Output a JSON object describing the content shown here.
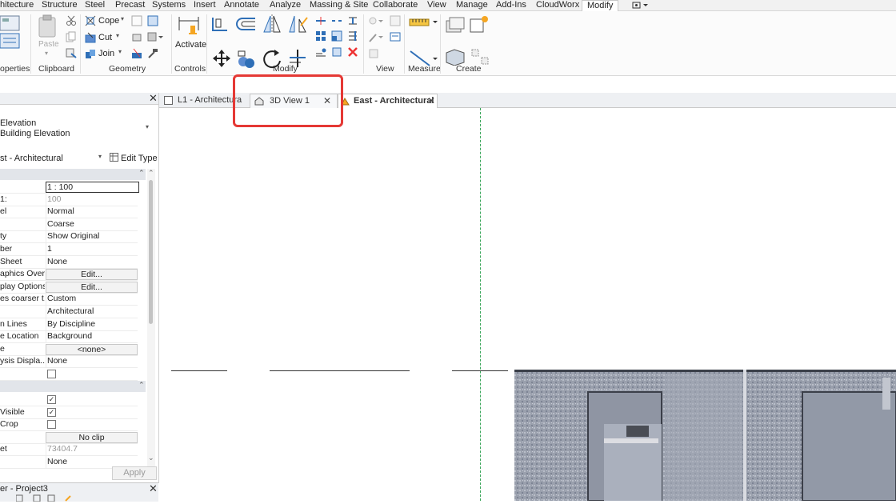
{
  "ribbon_tabs": [
    "hitecture",
    "Structure",
    "Steel",
    "Precast",
    "Systems",
    "Insert",
    "Annotate",
    "Analyze",
    "Massing & Site",
    "Collaborate",
    "View",
    "Manage",
    "Add-Ins",
    "CloudWorx",
    "Modify"
  ],
  "ribbon_panels": {
    "properties": "operties",
    "clipboard": "Clipboard",
    "geometry": "Geometry",
    "controls": "Controls",
    "modify": "Modify",
    "view": "View",
    "measure": "Measure",
    "create": "Create"
  },
  "clipboard": {
    "paste": "Paste"
  },
  "geometry": {
    "cope": "Cope",
    "cut": "Cut",
    "join": "Join"
  },
  "controls": {
    "activate": "Activate"
  },
  "properties": {
    "type_line1": "Elevation",
    "type_line2": "Building Elevation",
    "selector": "st - Architectural",
    "edit_type": "Edit Type",
    "rows": [
      {
        "k": "",
        "v": "1 : 100",
        "style": "box"
      },
      {
        "k": "1:",
        "v": "100",
        "style": "gray"
      },
      {
        "k": "el",
        "v": "Normal"
      },
      {
        "k": "",
        "v": "Coarse"
      },
      {
        "k": "ty",
        "v": "Show Original"
      },
      {
        "k": "ber",
        "v": "1"
      },
      {
        "k": "Sheet",
        "v": "None"
      },
      {
        "k": "aphics Over...",
        "v": "Edit...",
        "style": "btn"
      },
      {
        "k": "play Options",
        "v": "Edit...",
        "style": "btn"
      },
      {
        "k": "es coarser t...",
        "v": "Custom"
      },
      {
        "k": "",
        "v": "Architectural"
      },
      {
        "k": "n Lines",
        "v": "By Discipline"
      },
      {
        "k": "e Location",
        "v": "Background"
      },
      {
        "k": "e",
        "v": "<none>",
        "style": "btn"
      },
      {
        "k": "ysis Displa...",
        "v": "None"
      },
      {
        "k": "",
        "v": "",
        "style": "chk"
      }
    ],
    "rows2": [
      {
        "k": "",
        "v": "",
        "style": "chkon"
      },
      {
        "k": "Visible",
        "v": "",
        "style": "chkon"
      },
      {
        "k": "Crop",
        "v": "",
        "style": "chk"
      },
      {
        "k": "",
        "v": "No clip",
        "style": "btn"
      },
      {
        "k": "et",
        "v": "73404.7",
        "style": "gray"
      },
      {
        "k": "",
        "v": "None"
      }
    ],
    "apply": "Apply"
  },
  "browser": {
    "title": "er - Project3"
  },
  "view_tabs": [
    {
      "label": "L1 - Architectura",
      "icon": "floor-plan-icon"
    },
    {
      "label": "3D View 1",
      "icon": "house-3d-icon"
    },
    {
      "label": "East - Architectural",
      "icon": "elevation-icon",
      "active": true
    }
  ],
  "colors": {
    "highlight": "#e53935",
    "grid_line": "#3aa65a",
    "accent": "#2f6fb7"
  }
}
